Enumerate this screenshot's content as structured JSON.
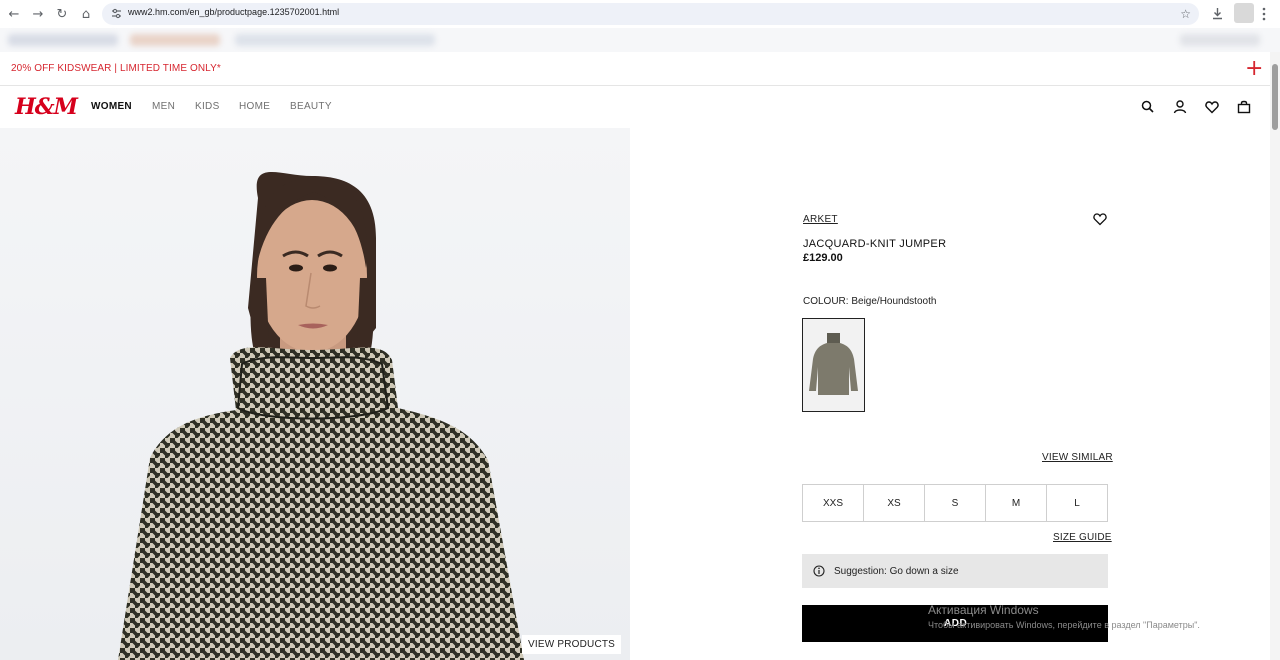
{
  "browser": {
    "url": "www2.hm.com/en_gb/productpage.1235702001.html",
    "nav": {
      "back": "←",
      "forward": "→",
      "reload": "↻",
      "home": "⌂"
    },
    "icons": {
      "star": "☆",
      "download": "download-icon",
      "menu": "⋮"
    }
  },
  "promo": {
    "text": "20% OFF KIDSWEAR | LIMITED TIME ONLY*",
    "plus": "+"
  },
  "header": {
    "logo": "H&M",
    "menu": [
      {
        "label": "WOMEN",
        "active": true
      },
      {
        "label": "MEN",
        "active": false
      },
      {
        "label": "KIDS",
        "active": false
      },
      {
        "label": "HOME",
        "active": false
      },
      {
        "label": "BEAUTY",
        "active": false
      }
    ]
  },
  "gallery": {
    "view_products": "VIEW PRODUCTS"
  },
  "product": {
    "brand": "ARKET",
    "name": "JACQUARD-KNIT JUMPER",
    "price": "£129.00",
    "colour_label": "COLOUR: Beige/Houndstooth",
    "view_similar": "VIEW SIMILAR",
    "sizes": [
      "XXS",
      "XS",
      "S",
      "M",
      "L"
    ],
    "size_guide": "SIZE GUIDE",
    "suggestion": "Suggestion: Go down a size",
    "add_label": "ADD"
  },
  "os_watermark": {
    "title": "Активация Windows",
    "subtitle": "Чтобы активировать Windows, перейдите в раздел \"Параметры\"."
  },
  "colors": {
    "accent_red": "#d6262f",
    "logo_red": "#d6001c",
    "add_button": "#000000",
    "suggestion_bg": "#e7e7e7"
  }
}
